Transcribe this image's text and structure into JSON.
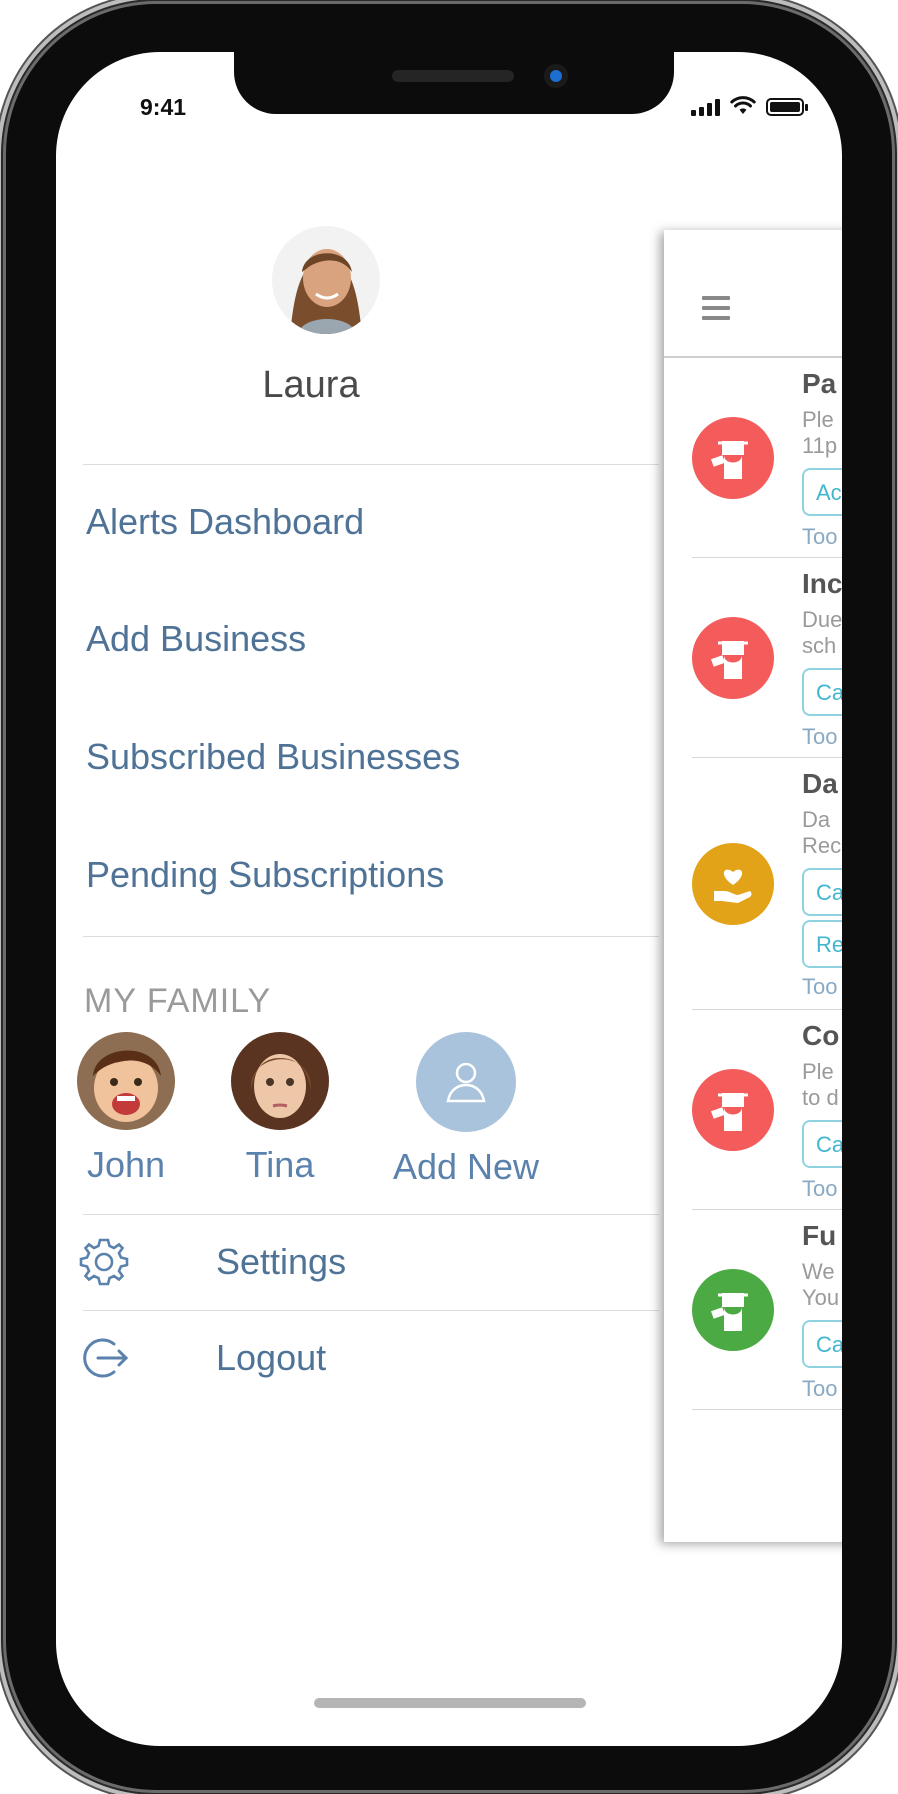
{
  "status_bar": {
    "time": "9:41"
  },
  "profile": {
    "name": "Laura"
  },
  "menu": {
    "items": [
      {
        "label": "Alerts Dashboard"
      },
      {
        "label": "Add Business"
      },
      {
        "label": "Subscribed Businesses"
      },
      {
        "label": "Pending Subscriptions"
      }
    ]
  },
  "family": {
    "title": "MY FAMILY",
    "members": [
      {
        "name": "John"
      },
      {
        "name": "Tina"
      }
    ],
    "add_label": "Add New"
  },
  "footer_menu": {
    "settings": "Settings",
    "logout": "Logout"
  },
  "dashboard": {
    "cards": [
      {
        "title": "Pa",
        "desc1": "Ple",
        "desc2": "11p",
        "chip1": "Ac",
        "time": "Too",
        "color": "#f45b5b"
      },
      {
        "title": "Inc",
        "desc1": "Due",
        "desc2": "sch",
        "chip1": "Ca",
        "time": "Too",
        "color": "#f45b5b"
      },
      {
        "title": "Da",
        "desc1": "Da",
        "desc2": "Rec",
        "chip1": "Ca",
        "chip2": "Re",
        "time": "Too",
        "color": "#e3a319"
      },
      {
        "title": "Co",
        "desc1": "Ple",
        "desc2": "to d",
        "chip1": "Ca",
        "time": "Too",
        "color": "#f45b5b"
      },
      {
        "title": "Fu",
        "desc1": "We",
        "desc2": "You",
        "chip1": "Ca",
        "time": "Too",
        "color": "#4caa45"
      }
    ]
  }
}
